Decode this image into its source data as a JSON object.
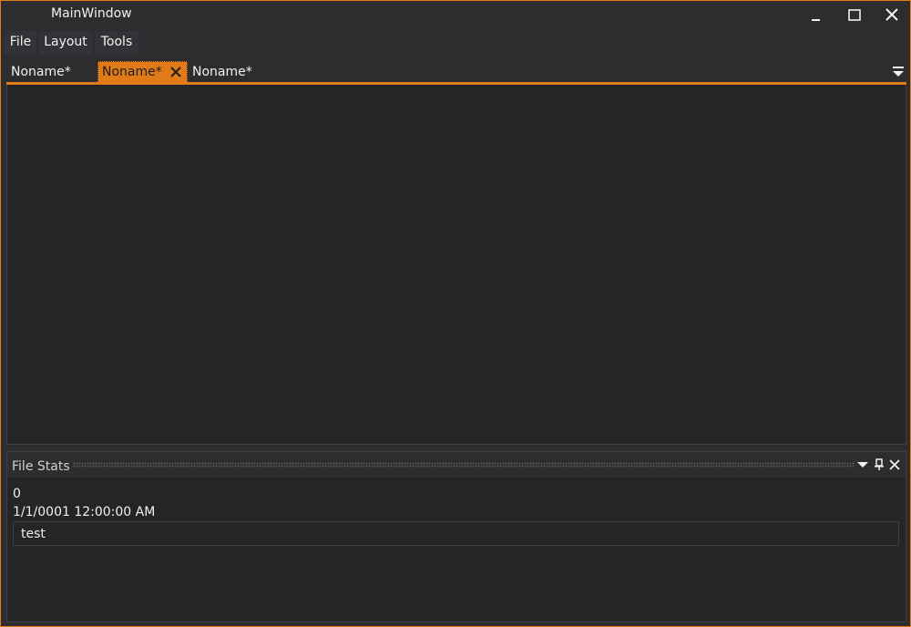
{
  "window": {
    "title": "MainWindow",
    "accent_color": "#e07b18",
    "background_color": "#2d2d30"
  },
  "title_buttons": {
    "minimize_icon": "minimize-icon",
    "maximize_icon": "maximize-icon",
    "close_icon": "close-icon"
  },
  "menu": {
    "items": [
      {
        "label": "File"
      },
      {
        "label": "Layout"
      },
      {
        "label": "Tools"
      }
    ]
  },
  "tabs": {
    "items": [
      {
        "label": "Noname*",
        "active": false
      },
      {
        "label": "Noname*",
        "active": true
      },
      {
        "label": "Noname*",
        "active": false
      }
    ],
    "overflow_icon": "tab-overflow-icon"
  },
  "panel": {
    "title": "File Stats",
    "count": "0",
    "date": "1/1/0001 12:00:00 AM",
    "text_value": "test"
  }
}
